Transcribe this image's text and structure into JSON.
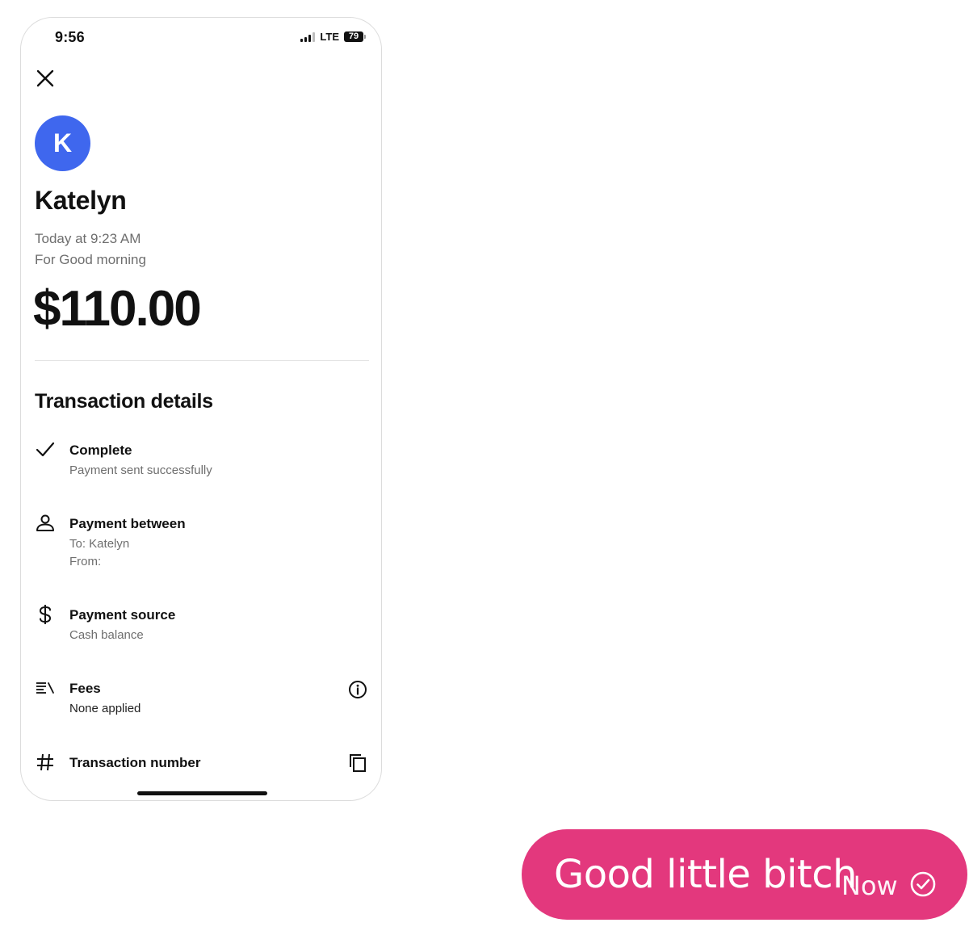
{
  "status_bar": {
    "time": "9:56",
    "network": "LTE",
    "battery": "79"
  },
  "header": {
    "close_icon": "close-icon"
  },
  "recipient": {
    "avatar_initial": "K",
    "avatar_color": "#3f67ee",
    "name": "Katelyn",
    "date": "Today at 9:23 AM",
    "note": "For Good morning"
  },
  "amount": "$110.00",
  "transaction": {
    "section_title": "Transaction details",
    "status": {
      "icon": "checkmark-icon",
      "title": "Complete",
      "subtitle": "Payment sent successfully"
    },
    "between": {
      "icon": "person-icon",
      "title": "Payment between",
      "to": "To: Katelyn",
      "from": "From:"
    },
    "source": {
      "icon": "dollar-icon",
      "title": "Payment source",
      "subtitle": "Cash balance"
    },
    "fees": {
      "icon": "fees-list-icon",
      "title": "Fees",
      "subtitle": "None applied",
      "info_icon": "info-icon"
    },
    "number": {
      "icon": "hash-icon",
      "title": "Transaction number",
      "copy_icon": "copy-icon"
    }
  },
  "message": {
    "text": "Good little bitch",
    "time": "Now",
    "status_icon": "delivered-check-icon",
    "bubble_color": "#e3387d"
  }
}
